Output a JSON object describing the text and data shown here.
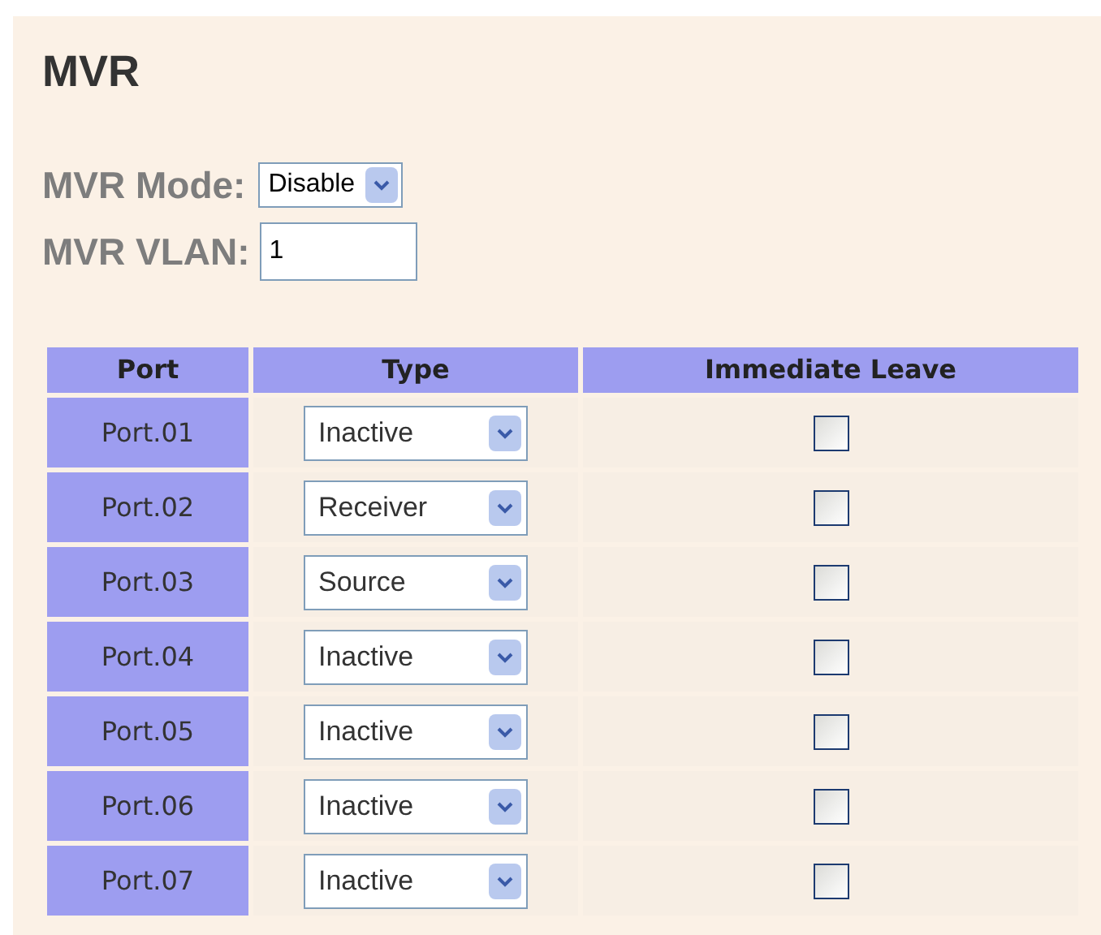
{
  "title": "MVR",
  "mode": {
    "label": "MVR Mode:",
    "value": "Disable"
  },
  "vlan": {
    "label": "MVR VLAN:",
    "value": "1"
  },
  "table": {
    "columns": [
      "Port",
      "Type",
      "Immediate Leave"
    ],
    "rows": [
      {
        "port": "Port.01",
        "type": "Inactive",
        "checked": false
      },
      {
        "port": "Port.02",
        "type": "Receiver",
        "checked": false
      },
      {
        "port": "Port.03",
        "type": "Source",
        "checked": false
      },
      {
        "port": "Port.04",
        "type": "Inactive",
        "checked": false
      },
      {
        "port": "Port.05",
        "type": "Inactive",
        "checked": false
      },
      {
        "port": "Port.06",
        "type": "Inactive",
        "checked": false
      },
      {
        "port": "Port.07",
        "type": "Inactive",
        "checked": false
      }
    ]
  }
}
